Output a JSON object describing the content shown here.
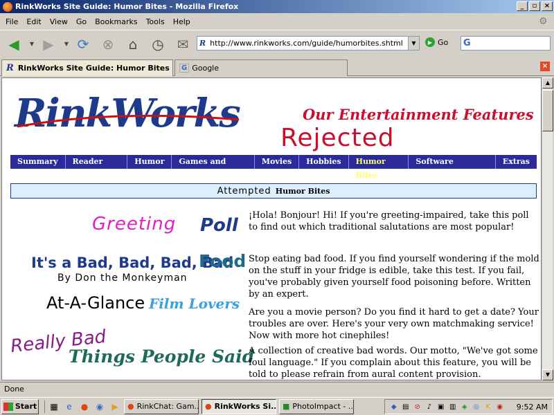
{
  "window": {
    "title": "RinkWorks Site Guide: Humor Bites - Mozilla Firefox"
  },
  "menu": [
    "File",
    "Edit",
    "View",
    "Go",
    "Bookmarks",
    "Tools",
    "Help"
  ],
  "toolbar": {
    "url": "http://www.rinkworks.com/guide/humorbites.shtml",
    "go_label": "Go"
  },
  "tabs": [
    {
      "label": "RinkWorks Site Guide: Humor Bites"
    },
    {
      "label": "Google"
    }
  ],
  "page": {
    "logo": "RinkWorks",
    "tagline": "Our Entertainment Features",
    "rejected": "Rejected",
    "nav": [
      "Summary",
      "Reader Areas",
      "Humor",
      "Games and Puzzles",
      "Movies",
      "Hobbies",
      "Humor Bites",
      "Software Downloads",
      "Extras"
    ],
    "section": {
      "scribble": "Attempted",
      "title": "Humor Bites"
    },
    "features": [
      {
        "title_a": "Greeting",
        "title_b": "Poll",
        "desc": "¡Hola! Bonjour! Hi! If you're greeting-impaired, take this poll to find out which traditional salutations are most popular!"
      },
      {
        "title_a": "It's a Bad, Bad, Bad, Bad",
        "title_b": "Food",
        "byline": "By Don the Monkeyman",
        "desc": "Stop eating bad food. If you find yourself wondering if the mold on the stuff in your fridge is edible, take this test. If you fail, you've probably given yourself food poisoning before. Written by an expert."
      },
      {
        "title_a": "At-A-Glance",
        "title_b": "Film Lovers",
        "desc": "Are you a movie person? Do you find it hard to get a date? Your troubles are over. Here's your very own matchmaking service! Now with more hot cinephiles!"
      },
      {
        "title_a": "Really Bad",
        "title_b": "Things People Said",
        "desc": "A collection of creative bad words. Our motto, \"We've got some foul language.\" If you complain about this feature, you will be told to please refrain from aural content provision."
      }
    ]
  },
  "status": {
    "text": "Done"
  },
  "taskbar": {
    "start": "Start",
    "windows": [
      "RinkChat: Gam...",
      "RinkWorks Si...",
      "PhotoImpact - ..."
    ],
    "clock": "9:52 AM"
  }
}
